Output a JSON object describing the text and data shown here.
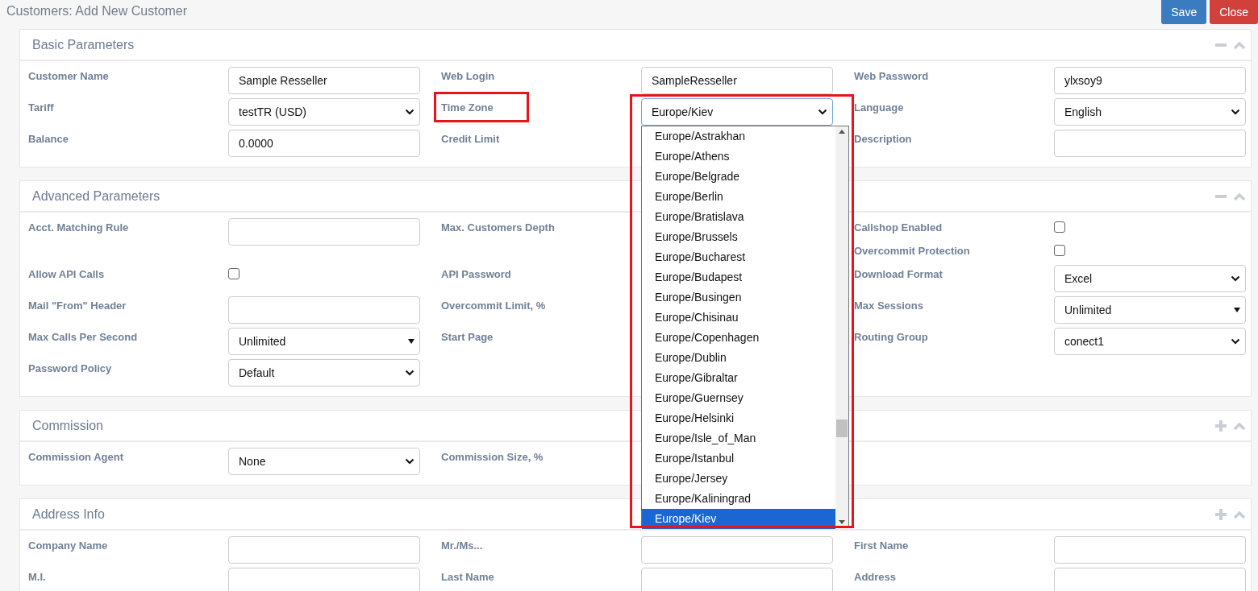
{
  "title": "Customers: Add New Customer",
  "buttons": [
    {
      "label": "Save",
      "kind": "primary"
    },
    {
      "label": "Close",
      "kind": "danger"
    }
  ],
  "sections": [
    {
      "title": "Basic Parameters",
      "collapsed": false,
      "rows": [
        [
          [
            {
              "label": "Customer Name",
              "kind": "text",
              "value": "Sample Resseller"
            }
          ],
          [
            {
              "label": "Web Login",
              "kind": "text",
              "value": "SampleResseller"
            }
          ],
          [
            {
              "label": "Web Password",
              "kind": "text",
              "value": "ylxsoy9"
            }
          ]
        ],
        [
          [
            {
              "label": "Tariff",
              "kind": "select",
              "value": "testTR (USD)"
            }
          ],
          [
            {
              "label": "Time Zone",
              "kind": "select",
              "value": "Europe/Kiev",
              "highlighted": true,
              "open": true,
              "options": [
                {
                  "label": "Europe/Astrakhan",
                  "selected": false
                },
                {
                  "label": "Europe/Athens",
                  "selected": false
                },
                {
                  "label": "Europe/Belgrade",
                  "selected": false
                },
                {
                  "label": "Europe/Berlin",
                  "selected": false
                },
                {
                  "label": "Europe/Bratislava",
                  "selected": false
                },
                {
                  "label": "Europe/Brussels",
                  "selected": false
                },
                {
                  "label": "Europe/Bucharest",
                  "selected": false
                },
                {
                  "label": "Europe/Budapest",
                  "selected": false
                },
                {
                  "label": "Europe/Busingen",
                  "selected": false
                },
                {
                  "label": "Europe/Chisinau",
                  "selected": false
                },
                {
                  "label": "Europe/Copenhagen",
                  "selected": false
                },
                {
                  "label": "Europe/Dublin",
                  "selected": false
                },
                {
                  "label": "Europe/Gibraltar",
                  "selected": false
                },
                {
                  "label": "Europe/Guernsey",
                  "selected": false
                },
                {
                  "label": "Europe/Helsinki",
                  "selected": false
                },
                {
                  "label": "Europe/Isle_of_Man",
                  "selected": false
                },
                {
                  "label": "Europe/Istanbul",
                  "selected": false
                },
                {
                  "label": "Europe/Jersey",
                  "selected": false
                },
                {
                  "label": "Europe/Kaliningrad",
                  "selected": false
                },
                {
                  "label": "Europe/Kiev",
                  "selected": true
                }
              ]
            }
          ],
          [
            {
              "label": "Language",
              "kind": "select",
              "value": "English"
            }
          ]
        ],
        [
          [
            {
              "label": "Balance",
              "kind": "text",
              "value": "0.0000"
            }
          ],
          [
            {
              "label": "Credit Limit",
              "kind": "label"
            }
          ],
          [
            {
              "label": "Description",
              "kind": "text"
            }
          ]
        ]
      ]
    },
    {
      "title": "Advanced Parameters",
      "collapsed": false,
      "rows": [
        [
          [
            {
              "label": "Acct. Matching Rule",
              "kind": "text"
            }
          ],
          [
            {
              "label": "Max. Customers Depth",
              "kind": "label"
            }
          ],
          [
            {
              "label": "Callshop Enabled",
              "kind": "checkbox",
              "checked": false
            },
            {
              "label": "Overcommit Protection",
              "kind": "checkbox",
              "checked": false
            }
          ]
        ],
        [
          [
            {
              "label": "Allow API Calls",
              "kind": "checkbox",
              "checked": false
            }
          ],
          [
            {
              "label": "API Password",
              "kind": "label"
            }
          ],
          [
            {
              "label": "Download Format",
              "kind": "select",
              "value": "Excel"
            }
          ]
        ],
        [
          [
            {
              "label": "Mail \"From\" Header",
              "kind": "text"
            }
          ],
          [
            {
              "label": "Overcommit Limit, %",
              "kind": "label"
            }
          ],
          [
            {
              "label": "Max Sessions",
              "kind": "combo",
              "value": "Unlimited"
            }
          ]
        ],
        [
          [
            {
              "label": "Max Calls Per Second",
              "kind": "combo",
              "value": "Unlimited"
            }
          ],
          [
            {
              "label": "Start Page",
              "kind": "label"
            }
          ],
          [
            {
              "label": "Routing Group",
              "kind": "select",
              "value": "conect1"
            }
          ]
        ],
        [
          [
            {
              "label": "Password Policy",
              "kind": "select",
              "value": "Default"
            }
          ],
          [],
          []
        ]
      ]
    },
    {
      "title": "Commission",
      "collapsed": true,
      "rows": [
        [
          [
            {
              "label": "Commission Agent",
              "kind": "select",
              "value": "None"
            }
          ],
          [
            {
              "label": "Commission Size, %",
              "kind": "label"
            }
          ],
          []
        ]
      ]
    },
    {
      "title": "Address Info",
      "collapsed": true,
      "rows": [
        [
          [
            {
              "label": "Company Name",
              "kind": "text"
            }
          ],
          [
            {
              "label": "Mr./Ms...",
              "kind": "text"
            }
          ],
          [
            {
              "label": "First Name",
              "kind": "text"
            }
          ]
        ],
        [
          [
            {
              "label": "M.I.",
              "kind": "text"
            }
          ],
          [
            {
              "label": "Last Name",
              "kind": "text"
            }
          ],
          [
            {
              "label": "Address",
              "kind": "text"
            }
          ]
        ]
      ]
    }
  ]
}
